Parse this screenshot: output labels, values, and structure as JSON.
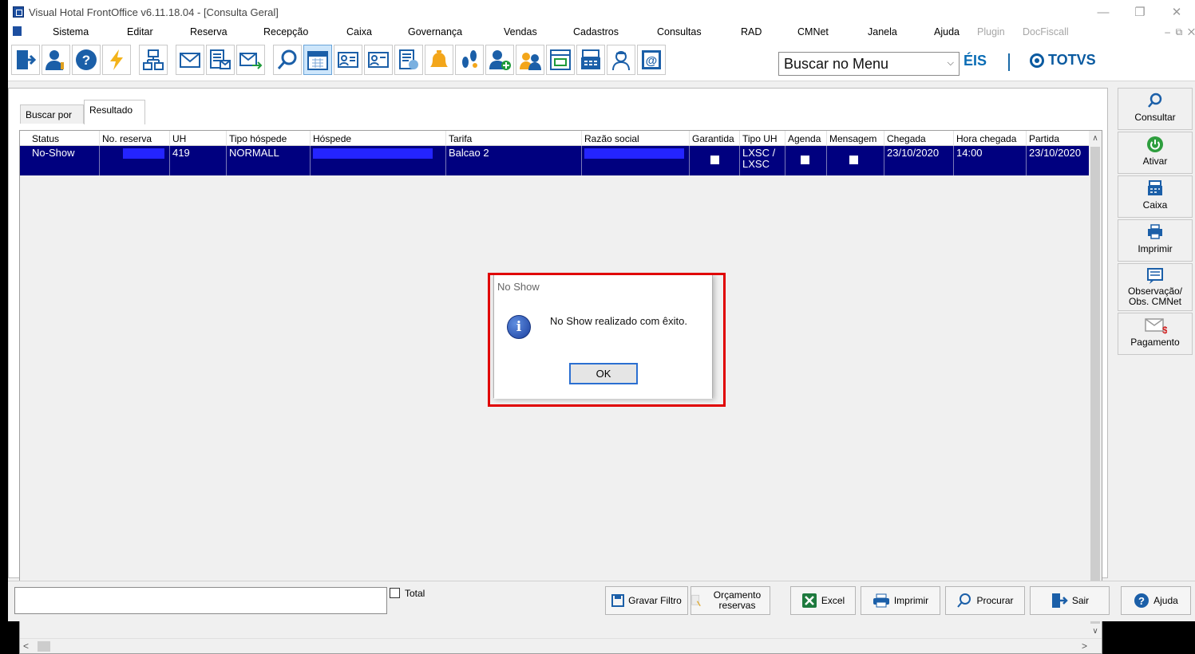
{
  "window": {
    "title": "Visual Hotal FrontOffice v6.11.18.04 - [Consulta Geral]"
  },
  "menu": {
    "items": [
      "Sistema",
      "Editar",
      "Reserva",
      "Recepção",
      "Caixa",
      "Governança",
      "Vendas",
      "Cadastros",
      "Consultas",
      "RAD",
      "CMNet",
      "Janela",
      "Ajuda"
    ],
    "disabled_items": [
      "Plugin",
      "DocFiscall"
    ]
  },
  "toolbar": {
    "search_text": "Buscar no Menu",
    "brand_eis": "ÉIS",
    "brand_totvs": "TOTVS",
    "icons": [
      "exit-door-icon",
      "user-key-icon",
      "help-icon",
      "lightning-icon",
      "network-icon",
      "mail-icon",
      "form-mail-icon",
      "send-mail-icon",
      "search-icon",
      "calendar-icon",
      "card-icon",
      "card2-icon",
      "report-icon",
      "bell-icon",
      "footprint-icon",
      "add-guest-icon",
      "guests-icon",
      "cash-window-icon",
      "register-icon",
      "maid-icon",
      "email-at-icon"
    ]
  },
  "tabs": [
    "Buscar por",
    "Resultado"
  ],
  "grid": {
    "columns": [
      "Status",
      "No. reserva",
      "UH",
      "Tipo hóspede",
      "Hóspede",
      "Tarifa",
      "Razão social",
      "Garantida",
      "Tipo UH",
      "Agenda",
      "Mensagem",
      "Chegada",
      "Hora chegada",
      "Partida"
    ],
    "row": {
      "status": "No-Show",
      "reserva": "",
      "uh": "419",
      "tipo_hospede": "NORMALL",
      "hospede": "",
      "tarifa": "Balcao 2",
      "razao_social": "",
      "garantida": false,
      "tipo_uh_1": "LXSC /",
      "tipo_uh_2": "LXSC",
      "agenda": false,
      "mensagem": false,
      "chegada": "23/10/2020",
      "hora_chegada": "14:00",
      "partida": "23/10/2020"
    }
  },
  "sidebar": [
    {
      "label": "Consultar",
      "icon": "search-icon"
    },
    {
      "label": "Ativar",
      "icon": "power-icon"
    },
    {
      "label": "Caixa",
      "icon": "cash-register-icon"
    },
    {
      "label": "Imprimir",
      "icon": "printer-icon"
    },
    {
      "label": "Observação/ Obs. CMNet",
      "icon": "note-icon"
    },
    {
      "label": "Pagamento",
      "icon": "payment-mail-icon"
    }
  ],
  "bottom": {
    "filter_value": "",
    "total_label": "Total",
    "buttons": [
      "Gravar Filtro",
      "Orçamento reservas",
      "Excel",
      "Imprimir",
      "Procurar",
      "Sair",
      "Ajuda"
    ]
  },
  "dialog": {
    "title": "No Show",
    "message": "No Show realizado com êxito.",
    "ok": "OK"
  },
  "colors": {
    "selection": "#00007f",
    "highlight": "#e00000",
    "accent": "#0a5aa0"
  }
}
